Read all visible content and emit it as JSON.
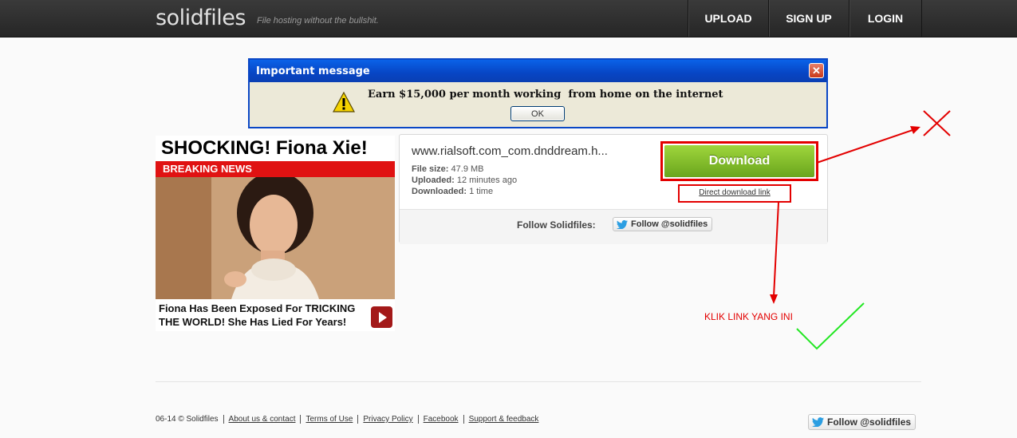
{
  "header": {
    "logo": "solidfiles",
    "tagline": "File hosting without the bullshit.",
    "nav": [
      "UPLOAD",
      "SIGN UP",
      "LOGIN"
    ]
  },
  "dialog": {
    "title": "Important message",
    "close": "✕",
    "message": "Earn $15,000 per month working  from home on the internet",
    "ok": "OK"
  },
  "ad": {
    "headline": "SHOCKING! Fiona Xie!",
    "breaking": "BREAKING NEWS",
    "caption": "Fiona Has Been Exposed For TRICKING THE WORLD! She Has Lied For Years!"
  },
  "file": {
    "name": "www.rialsoft.com_com.dnddream.h...",
    "size_label": "File size:",
    "size": "47.9 MB",
    "uploaded_label": "Uploaded:",
    "uploaded": "12 minutes ago",
    "downloaded_label": "Downloaded:",
    "downloaded": "1 time",
    "download_button": "Download",
    "direct_link": "Direct download link",
    "follow_label": "Follow Solidfiles:",
    "follow_button": "Follow @solidfiles"
  },
  "annotation": {
    "klik": "KLIK LINK YANG INI",
    "color": "#e30000"
  },
  "footer": {
    "copyright": "06-14 © Solidfiles",
    "links": [
      "About us & contact",
      "Terms of Use",
      "Privacy Policy",
      "Facebook",
      "Support & feedback"
    ],
    "follow_button": "Follow @solidfiles"
  }
}
